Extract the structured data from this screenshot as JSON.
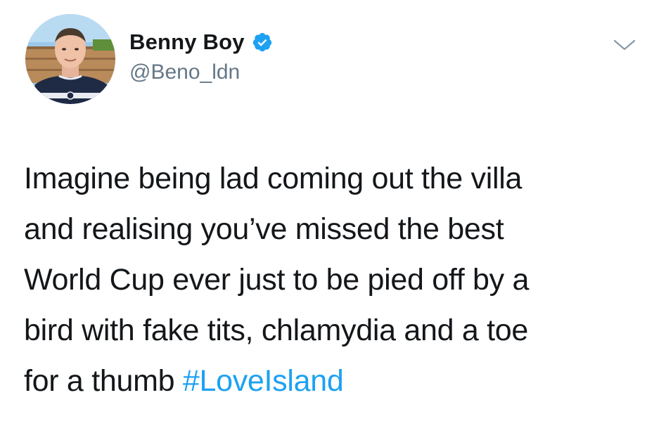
{
  "user": {
    "display_name": "Benny Boy",
    "handle": "@Beno_ldn",
    "verified": true
  },
  "tweet": {
    "lines": [
      "Imagine being lad coming out the villa",
      "and realising you’ve missed the best",
      "World Cup ever just to be pied off by a",
      "bird with fake tits, chlamydia and a toe",
      "for a thumb "
    ],
    "hashtag": "#LoveIsland"
  },
  "icons": {
    "verified": "verified-badge-icon",
    "menu": "chevron-down-icon"
  },
  "colors": {
    "accent": "#1da1f2",
    "text": "#14171a",
    "secondary_text": "#657786",
    "background": "#ffffff"
  }
}
